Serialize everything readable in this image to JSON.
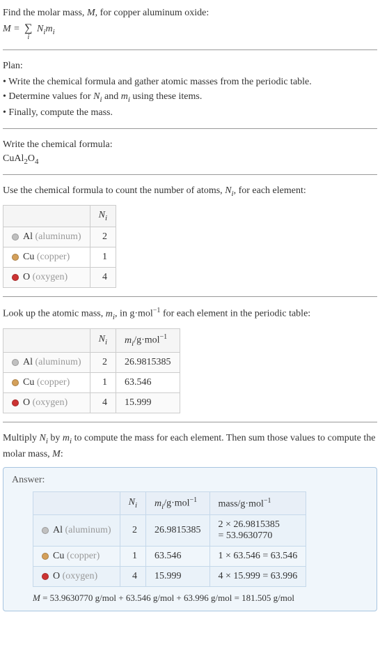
{
  "intro": {
    "line1_a": "Find the molar mass, ",
    "line1_b": ", for copper aluminum oxide:",
    "M": "M",
    "eq": " = ",
    "sum": "∑",
    "sum_idx": "i",
    "Ni": "N",
    "Ni_sub": "i",
    "mi": "m",
    "mi_sub": "i"
  },
  "plan": {
    "title": "Plan:",
    "b1_a": "Write the chemical formula and gather atomic masses from the periodic table.",
    "b2_a": "Determine values for ",
    "b2_b": " and ",
    "b2_c": " using these items.",
    "b3": "Finally, compute the mass."
  },
  "step1": {
    "title": "Write the chemical formula:",
    "formula_a": "CuAl",
    "formula_b": "2",
    "formula_c": "O",
    "formula_d": "4"
  },
  "step2": {
    "title_a": "Use the chemical formula to count the number of atoms, ",
    "title_b": ", for each element:",
    "Ni_hdr": "N",
    "Ni_hdr_sub": "i",
    "rows": [
      {
        "dot": "dot-al",
        "sym": "Al",
        "name": " (aluminum)",
        "n": "2"
      },
      {
        "dot": "dot-cu",
        "sym": "Cu",
        "name": " (copper)",
        "n": "1"
      },
      {
        "dot": "dot-o",
        "sym": "O",
        "name": " (oxygen)",
        "n": "4"
      }
    ]
  },
  "step3": {
    "title_a": "Look up the atomic mass, ",
    "title_b": ", in g·mol",
    "title_c": " for each element in the periodic table:",
    "sup_neg1": "−1",
    "hdr_m": "m",
    "hdr_m_sub": "i",
    "hdr_unit": "/g·mol",
    "rows": [
      {
        "dot": "dot-al",
        "sym": "Al",
        "name": " (aluminum)",
        "n": "2",
        "m": "26.9815385"
      },
      {
        "dot": "dot-cu",
        "sym": "Cu",
        "name": " (copper)",
        "n": "1",
        "m": "63.546"
      },
      {
        "dot": "dot-o",
        "sym": "O",
        "name": " (oxygen)",
        "n": "4",
        "m": "15.999"
      }
    ]
  },
  "step4": {
    "text_a": "Multiply ",
    "text_b": " by ",
    "text_c": " to compute the mass for each element. Then sum those values to compute the molar mass, ",
    "text_d": ":"
  },
  "answer": {
    "label": "Answer:",
    "hdr_mass": "mass/g·mol",
    "rows": [
      {
        "dot": "dot-al",
        "sym": "Al",
        "name": " (aluminum)",
        "n": "2",
        "m": "26.9815385",
        "calc_a": "2 × 26.9815385",
        "calc_b": "= 53.9630770"
      },
      {
        "dot": "dot-cu",
        "sym": "Cu",
        "name": " (copper)",
        "n": "1",
        "m": "63.546",
        "calc_a": "1 × 63.546 = 63.546",
        "calc_b": ""
      },
      {
        "dot": "dot-o",
        "sym": "O",
        "name": " (oxygen)",
        "n": "4",
        "m": "15.999",
        "calc_a": "4 × 15.999 = 63.996",
        "calc_b": ""
      }
    ],
    "final_a": "M",
    "final_b": " = 53.9630770 g/mol + 63.546 g/mol + 63.996 g/mol = 181.505 g/mol"
  }
}
